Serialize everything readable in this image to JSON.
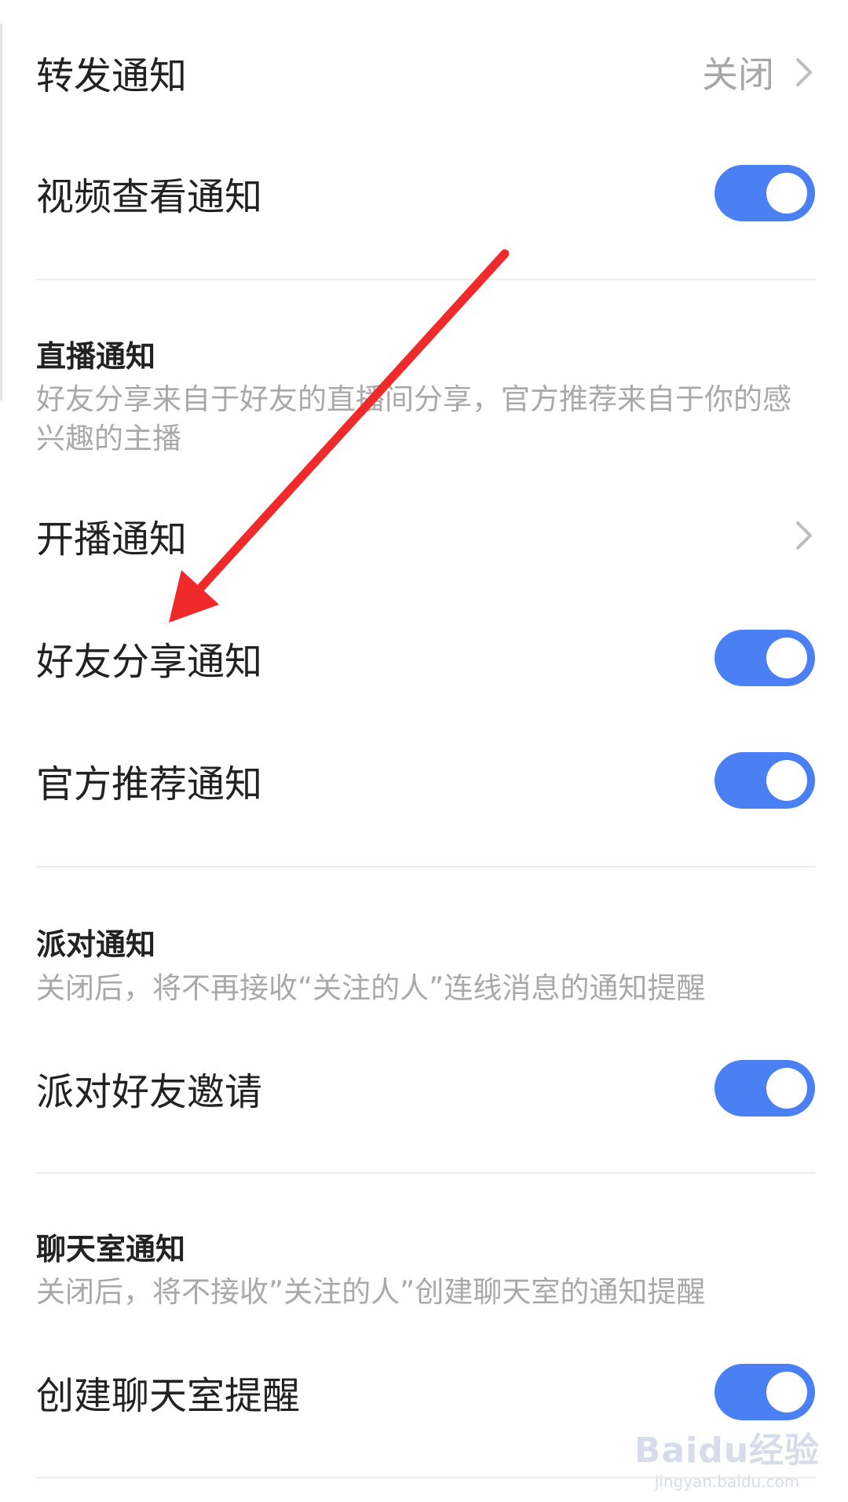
{
  "forward_notification": {
    "label": "转发通知",
    "value": "关闭",
    "chevron_icon": "chevron-right-icon"
  },
  "video_view_notification": {
    "label": "视频查看通知",
    "toggle_on": true
  },
  "live_section": {
    "title": "直播通知",
    "description": "好友分享来自于好友的直播间分享，官方推荐来自于你的感兴趣的主播"
  },
  "start_live_notification": {
    "label": "开播通知",
    "chevron_icon": "chevron-right-icon"
  },
  "friend_share_notification": {
    "label": "好友分享通知",
    "toggle_on": true
  },
  "official_recommend_notification": {
    "label": "官方推荐通知",
    "toggle_on": true
  },
  "party_section": {
    "title": "派对通知",
    "description": "关闭后，将不再接收“关注的人”连线消息的通知提醒"
  },
  "party_friend_invite": {
    "label": "派对好友邀请",
    "toggle_on": true
  },
  "chatroom_section": {
    "title": "聊天室通知",
    "description": "关闭后，将不接收”关注的人”创建聊天室的通知提醒"
  },
  "create_chatroom_reminder": {
    "label": "创建聊天室提醒",
    "toggle_on": true
  },
  "watermark": {
    "logo": "Baidu经验",
    "url": "jingyan.baidu.com"
  },
  "colors": {
    "toggle_on": "#4b80f4",
    "annotation_arrow": "#f02a2a",
    "secondary_text": "#a9a9a9"
  }
}
